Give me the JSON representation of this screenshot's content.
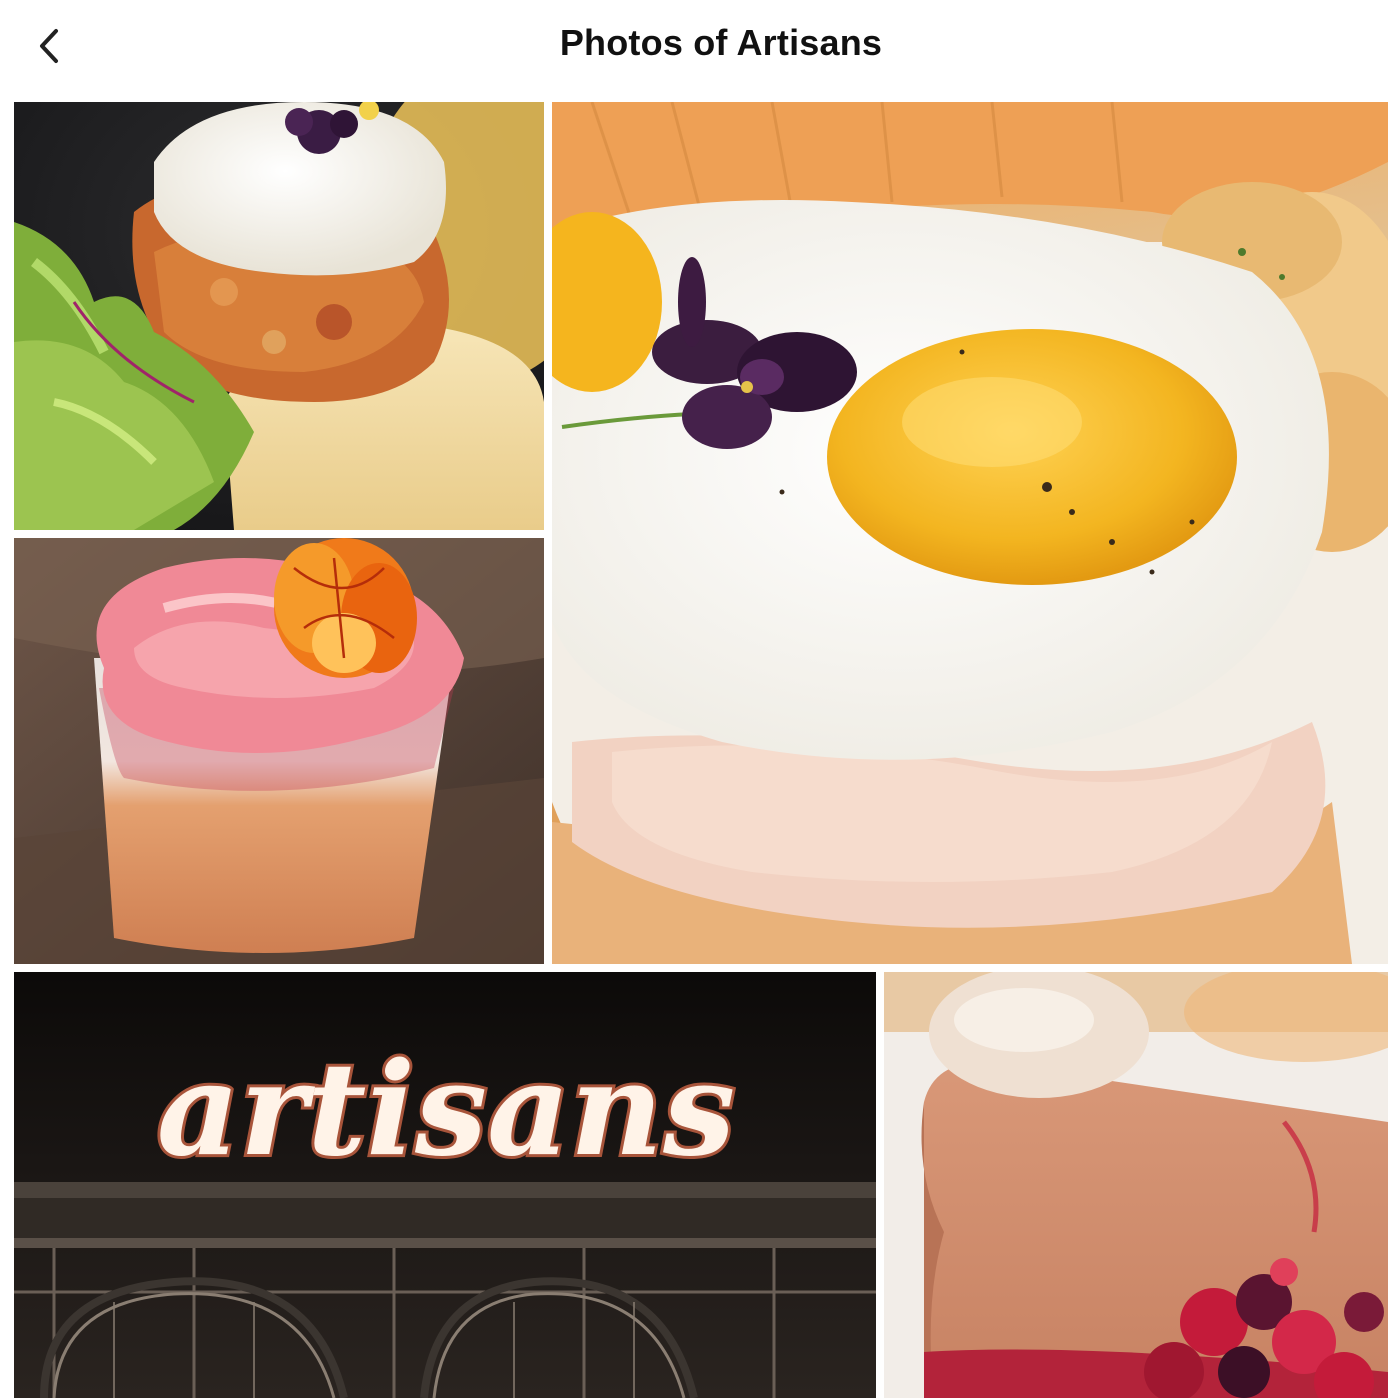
{
  "header": {
    "title": "Photos of Artisans",
    "back_icon": "chevron-left-icon"
  },
  "photos": [
    {
      "name": "photo-poached-egg-crabcake",
      "subject": "poached egg on crab cake with greens"
    },
    {
      "name": "photo-fried-egg-croissant",
      "subject": "fried egg on ham croissant with violet flower"
    },
    {
      "name": "photo-pink-cocktail",
      "subject": "pink foam cocktail with orange flower"
    },
    {
      "name": "photo-restaurant-sign",
      "subject": "artisans restaurant sign at night",
      "sign_text": "artisans"
    },
    {
      "name": "photo-mousse-dessert",
      "subject": "chocolate mousse dessert with berries"
    }
  ],
  "colors": {
    "background": "#ffffff",
    "title": "#111111"
  }
}
